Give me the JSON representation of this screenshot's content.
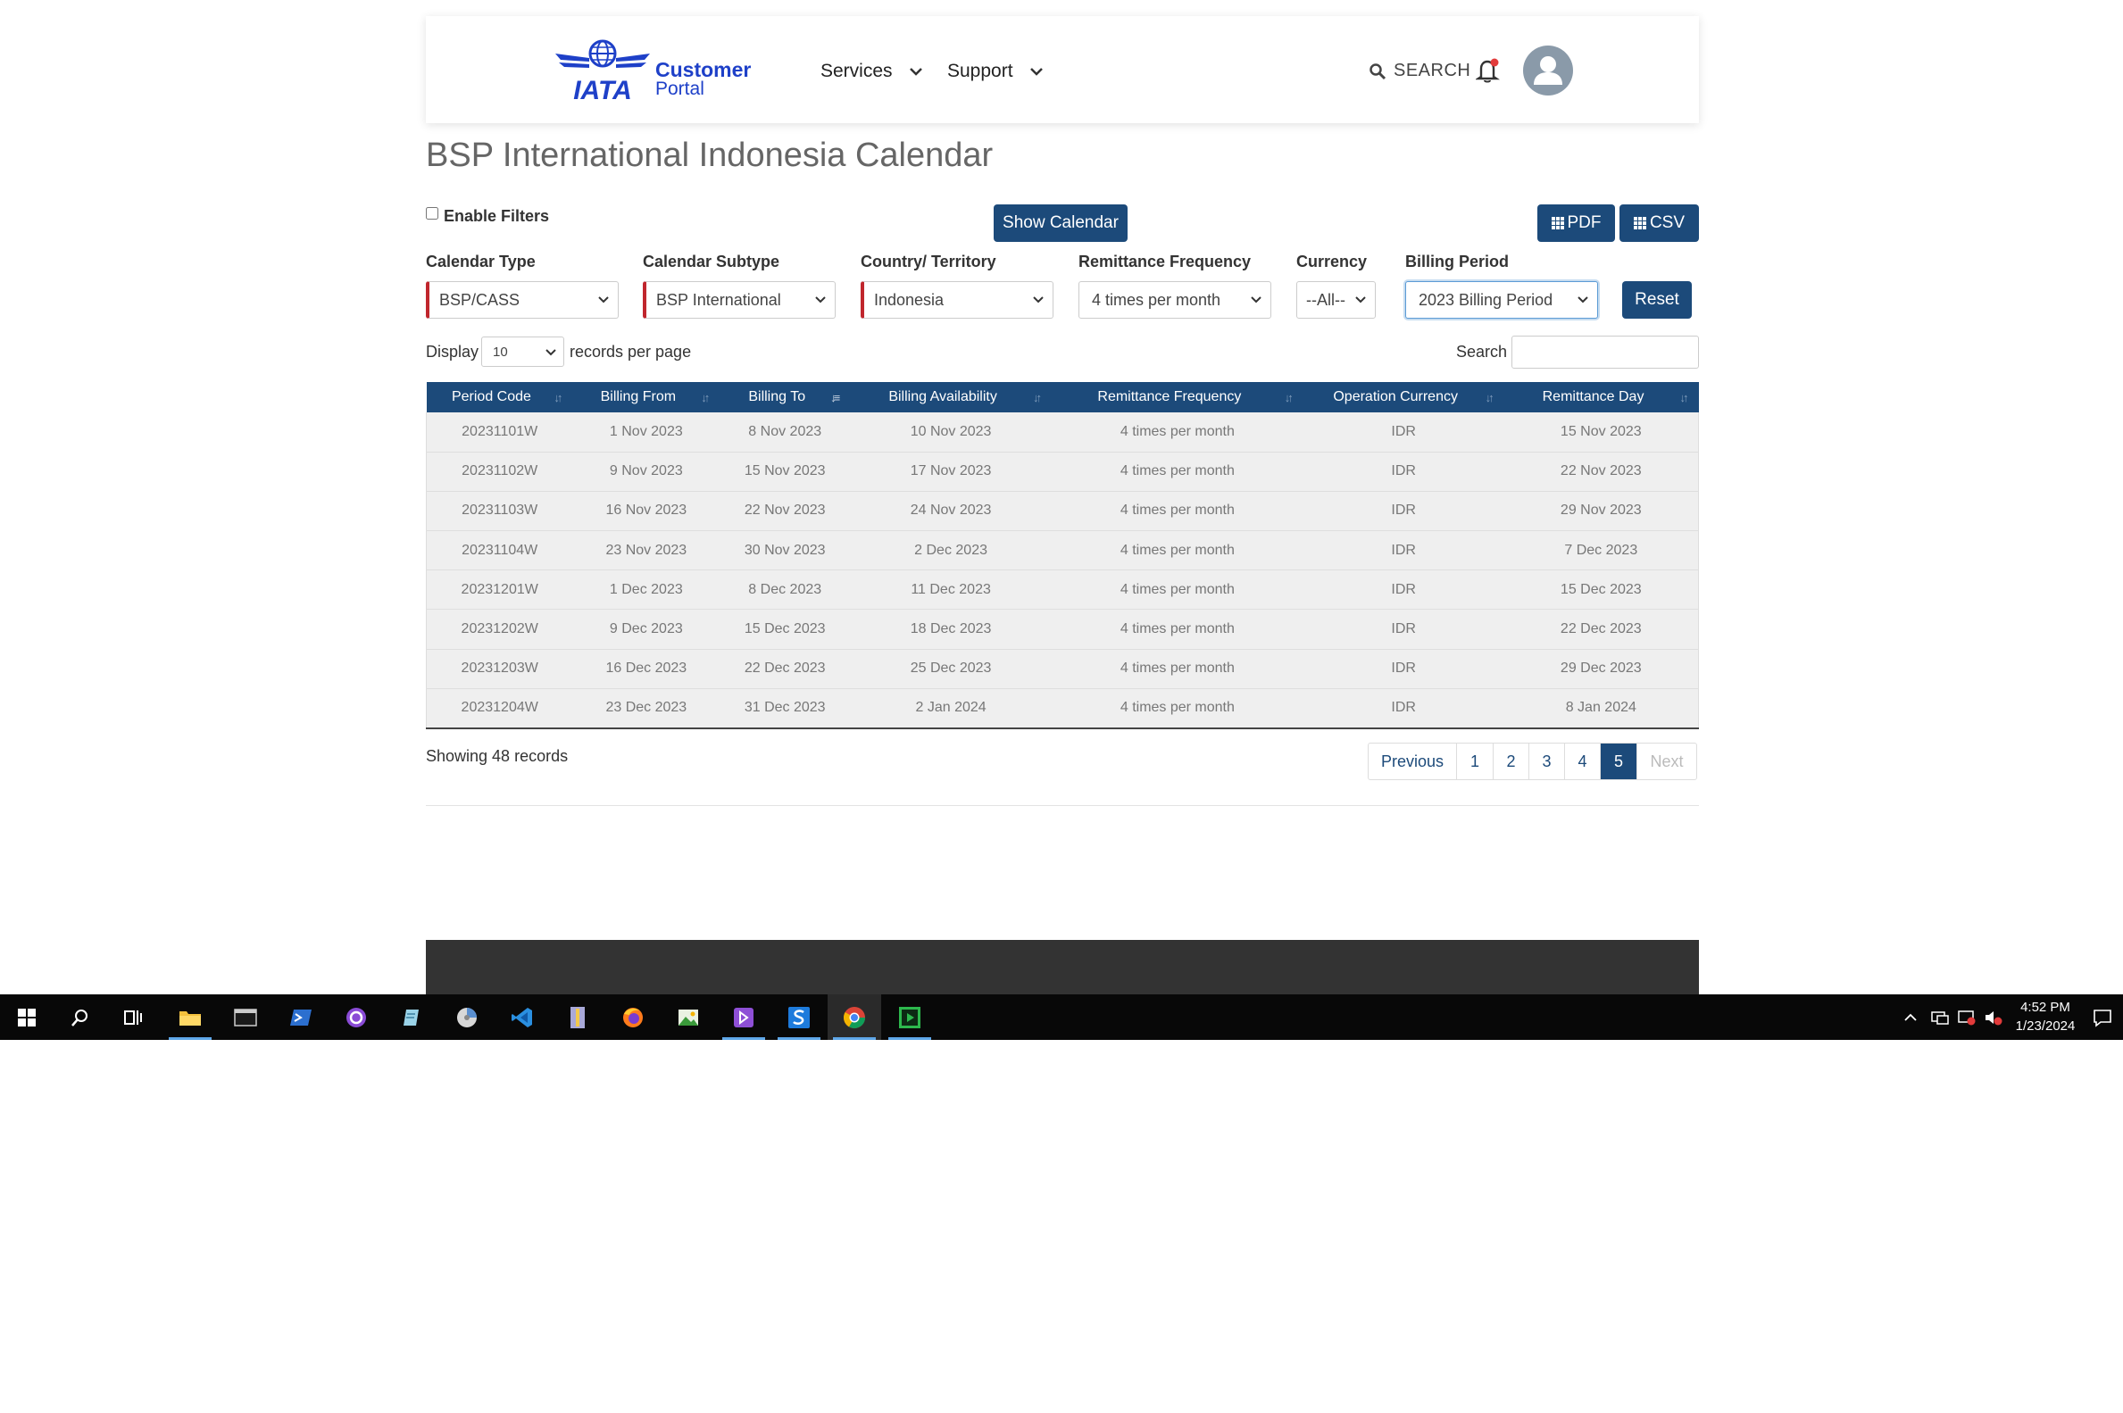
{
  "header": {
    "logo_text": "IATA",
    "brand_line1": "Customer",
    "brand_line2": "Portal",
    "nav": [
      {
        "label": "Services"
      },
      {
        "label": "Support"
      }
    ],
    "search_label": "SEARCH"
  },
  "page": {
    "title": "BSP International Indonesia Calendar"
  },
  "controls": {
    "enable_filters_label": "Enable Filters",
    "show_calendar_label": "Show Calendar",
    "pdf_label": "PDF",
    "csv_label": "CSV",
    "reset_label": "Reset"
  },
  "filters": {
    "calendar_type": {
      "label": "Calendar Type",
      "value": "BSP/CASS"
    },
    "calendar_subtype": {
      "label": "Calendar Subtype",
      "value": "BSP International"
    },
    "country": {
      "label": "Country/ Territory",
      "value": "Indonesia"
    },
    "remittance_frequency": {
      "label": "Remittance Frequency",
      "value": "4 times per month"
    },
    "currency": {
      "label": "Currency",
      "value": "--All--"
    },
    "billing_period": {
      "label": "Billing Period",
      "value": "2023 Billing Period"
    }
  },
  "table_controls": {
    "display_label": "Display",
    "page_length": "10",
    "records_label": "records per page",
    "search_label": "Search"
  },
  "table": {
    "columns": [
      "Period Code",
      "Billing From",
      "Billing To",
      "Billing Availability",
      "Remittance Frequency",
      "Operation Currency",
      "Remittance Day"
    ],
    "sorted_column": "Billing To",
    "rows": [
      [
        "20231101W",
        "1 Nov 2023",
        "8 Nov 2023",
        "10 Nov 2023",
        "4 times per month",
        "IDR",
        "15 Nov 2023"
      ],
      [
        "20231102W",
        "9 Nov 2023",
        "15 Nov 2023",
        "17 Nov 2023",
        "4 times per month",
        "IDR",
        "22 Nov 2023"
      ],
      [
        "20231103W",
        "16 Nov 2023",
        "22 Nov 2023",
        "24 Nov 2023",
        "4 times per month",
        "IDR",
        "29 Nov 2023"
      ],
      [
        "20231104W",
        "23 Nov 2023",
        "30 Nov 2023",
        "2 Dec 2023",
        "4 times per month",
        "IDR",
        "7 Dec 2023"
      ],
      [
        "20231201W",
        "1 Dec 2023",
        "8 Dec 2023",
        "11 Dec 2023",
        "4 times per month",
        "IDR",
        "15 Dec 2023"
      ],
      [
        "20231202W",
        "9 Dec 2023",
        "15 Dec 2023",
        "18 Dec 2023",
        "4 times per month",
        "IDR",
        "22 Dec 2023"
      ],
      [
        "20231203W",
        "16 Dec 2023",
        "22 Dec 2023",
        "25 Dec 2023",
        "4 times per month",
        "IDR",
        "29 Dec 2023"
      ],
      [
        "20231204W",
        "23 Dec 2023",
        "31 Dec 2023",
        "2 Jan 2024",
        "4 times per month",
        "IDR",
        "8 Jan 2024"
      ]
    ]
  },
  "pagination": {
    "showing_text": "Showing 48 records",
    "previous_label": "Previous",
    "pages": [
      "1",
      "2",
      "3",
      "4",
      "5"
    ],
    "active_page": "5",
    "next_label": "Next"
  },
  "taskbar": {
    "apps": [
      "start",
      "search",
      "task-view",
      "file-explorer",
      "terminal",
      "powershell",
      "github-desktop",
      "notepad",
      "disk-cleanup",
      "vscode",
      "archive",
      "firefox",
      "image-viewer",
      "visual-studio",
      "slack-s",
      "chrome",
      "media-player"
    ],
    "time": "4:52 PM",
    "date": "1/23/2024"
  },
  "colors": {
    "primary": "#1c4a7a",
    "brand_blue": "#1e40c8",
    "required_marker": "#c0262d",
    "footer": "#333333"
  }
}
